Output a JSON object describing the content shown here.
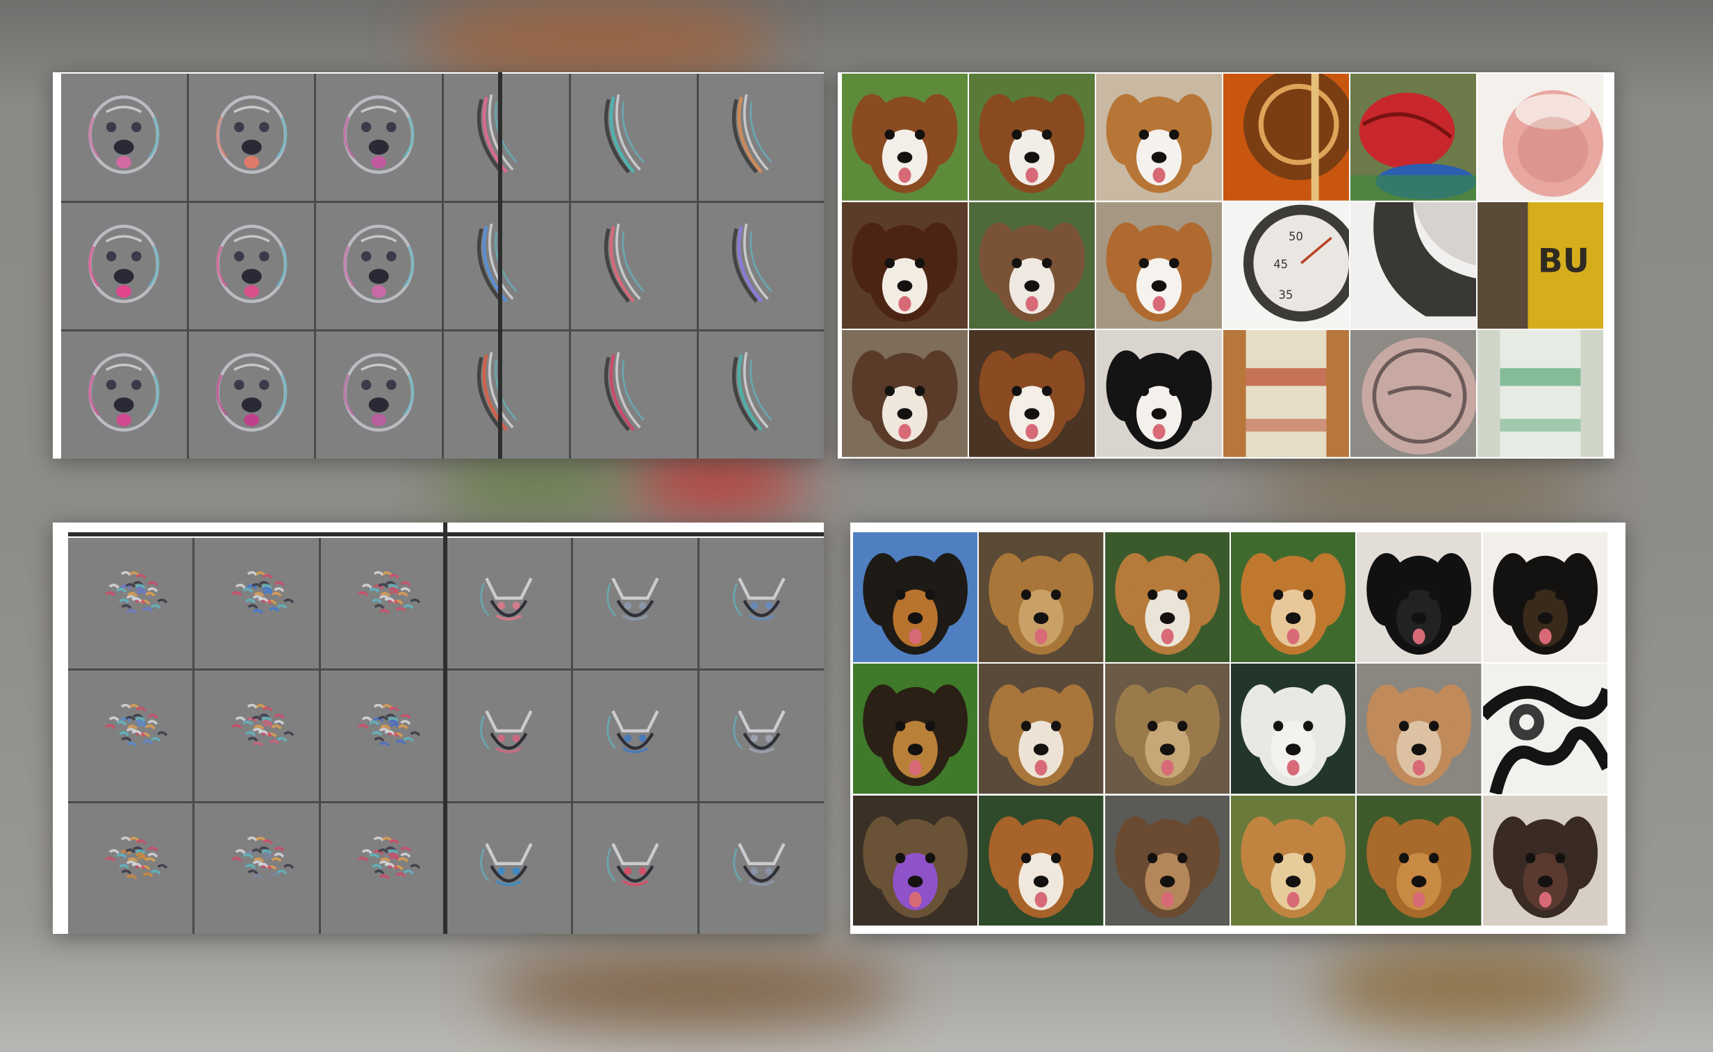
{
  "panels": [
    {
      "id": "top-feature-vis",
      "kind": "feature-visualizations",
      "cols": 6,
      "rows": 3,
      "cells": [
        {
          "motif": "dog-face",
          "hue": "#d36aa2"
        },
        {
          "motif": "dog-face",
          "hue": "#e07a6a"
        },
        {
          "motif": "dog-face",
          "hue": "#c25aa0"
        },
        {
          "motif": "curve",
          "hue": "#d96a8f"
        },
        {
          "motif": "curve",
          "hue": "#4fb3b0"
        },
        {
          "motif": "curve",
          "hue": "#d08a5a"
        },
        {
          "motif": "dog-face",
          "hue": "#e0458c"
        },
        {
          "motif": "dog-face",
          "hue": "#d9508d"
        },
        {
          "motif": "dog-face",
          "hue": "#c86aa6"
        },
        {
          "motif": "curve",
          "hue": "#5a8fd0"
        },
        {
          "motif": "curve",
          "hue": "#d6697a"
        },
        {
          "motif": "curve",
          "hue": "#8a7ad8"
        },
        {
          "motif": "dog-face",
          "hue": "#d04a90"
        },
        {
          "motif": "dog-face",
          "hue": "#c0408c"
        },
        {
          "motif": "dog-face",
          "hue": "#b8609e"
        },
        {
          "motif": "curve",
          "hue": "#d2604a"
        },
        {
          "motif": "curve",
          "hue": "#c94a6a"
        },
        {
          "motif": "curve",
          "hue": "#4fb0a8"
        }
      ]
    },
    {
      "id": "top-photos",
      "kind": "image-patches",
      "cols": 6,
      "rows": 3,
      "cells": [
        {
          "subject": "dog",
          "bg": "#5e8b3a",
          "coat": "#8a4a22",
          "face": "#f3efe8"
        },
        {
          "subject": "dog",
          "bg": "#5a7a3a",
          "coat": "#8a4a20",
          "face": "#f2ede6"
        },
        {
          "subject": "dog",
          "bg": "#c9b9a3",
          "coat": "#b77636",
          "face": "#f5f2ee"
        },
        {
          "subject": "guitar",
          "bg": "#c9560f",
          "main": "#7a3e12",
          "accent": "#e0a35a"
        },
        {
          "subject": "bird",
          "bg": "#6d7a4a",
          "main": "#c8272b",
          "accent": "#2c5fb0"
        },
        {
          "subject": "bowl",
          "bg": "#f4f0ec",
          "main": "#e8a7a0",
          "accent": "#c9796f"
        },
        {
          "subject": "dog",
          "bg": "#5b3b2a",
          "coat": "#4b2414",
          "face": "#f3ece3"
        },
        {
          "subject": "dog",
          "bg": "#4f6a3a",
          "coat": "#7a5236",
          "face": "#efe9e2"
        },
        {
          "subject": "dog",
          "bg": "#a59782",
          "coat": "#b06a30",
          "face": "#f6f2ed"
        },
        {
          "subject": "gauge",
          "bg": "#f5f4f2",
          "main": "#3c3b38",
          "accent": "#eae7e2"
        },
        {
          "subject": "strap",
          "bg": "#f1f0ee",
          "main": "#3a3835",
          "accent": "#d6d3cf"
        },
        {
          "subject": "tin",
          "bg": "#7a6a52",
          "main": "#d6ad1d",
          "accent": "#2f2a22"
        },
        {
          "subject": "dog",
          "bg": "#7d6d5a",
          "coat": "#5a3a28",
          "face": "#efe6dc"
        },
        {
          "subject": "dog",
          "bg": "#4a3424",
          "coat": "#8a4a22",
          "face": "#f4eee6"
        },
        {
          "subject": "dog",
          "bg": "#d9d4ce",
          "coat": "#141414",
          "face": "#f4f1ec"
        },
        {
          "subject": "can",
          "bg": "#b8763a",
          "main": "#e7ddc6",
          "accent": "#b8452a"
        },
        {
          "subject": "lid",
          "bg": "#8e8a86",
          "main": "#c7a8a2",
          "accent": "#6a5a58"
        },
        {
          "subject": "can",
          "bg": "#cfd6c8",
          "main": "#e6ebe3",
          "accent": "#5aa878"
        }
      ]
    },
    {
      "id": "bottom-feature-vis",
      "kind": "feature-visualizations",
      "cols": 6,
      "rows": 3,
      "cells": [
        {
          "motif": "blob",
          "hue": "#6a7ad0"
        },
        {
          "motif": "blob",
          "hue": "#3f7ad8"
        },
        {
          "motif": "blob",
          "hue": "#d0506a"
        },
        {
          "motif": "fox",
          "hue": "#d47a8a"
        },
        {
          "motif": "fox",
          "hue": "#8a96a8"
        },
        {
          "motif": "fox",
          "hue": "#6a8ab8"
        },
        {
          "motif": "blob",
          "hue": "#5a8ad0"
        },
        {
          "motif": "blob",
          "hue": "#d0607a"
        },
        {
          "motif": "blob",
          "hue": "#4a70c8"
        },
        {
          "motif": "fox",
          "hue": "#c86a80"
        },
        {
          "motif": "fox",
          "hue": "#4a7ab8"
        },
        {
          "motif": "fox",
          "hue": "#9aa0ae"
        },
        {
          "motif": "blob",
          "hue": "#d08a3a"
        },
        {
          "motif": "blob",
          "hue": "#7a86a0"
        },
        {
          "motif": "blob",
          "hue": "#d04a6a"
        },
        {
          "motif": "fox",
          "hue": "#3f8ac0"
        },
        {
          "motif": "fox",
          "hue": "#d0506a"
        },
        {
          "motif": "fox",
          "hue": "#8a92a6"
        }
      ]
    },
    {
      "id": "bottom-photos",
      "kind": "image-patches",
      "cols": 6,
      "rows": 3,
      "cells": [
        {
          "subject": "dog",
          "bg": "#4f7fc0",
          "coat": "#1e1a16",
          "face": "#b8732e"
        },
        {
          "subject": "dog",
          "bg": "#5a4a36",
          "coat": "#a87638",
          "face": "#c9a066"
        },
        {
          "subject": "dog",
          "bg": "#3a5a2c",
          "coat": "#b67a3a",
          "face": "#ebe4d8"
        },
        {
          "subject": "dog",
          "bg": "#3f6a2e",
          "coat": "#c0782f",
          "face": "#e8c89a"
        },
        {
          "subject": "dog",
          "bg": "#e2ddd7",
          "coat": "#111111",
          "face": "#222222"
        },
        {
          "subject": "dog",
          "bg": "#f2efea",
          "coat": "#141210",
          "face": "#3a2a1c"
        },
        {
          "subject": "dog",
          "bg": "#3f7a2a",
          "coat": "#2a2016",
          "face": "#b9803a"
        },
        {
          "subject": "dog",
          "bg": "#5a4a3a",
          "coat": "#a8753a",
          "face": "#ece3d4"
        },
        {
          "subject": "dog",
          "bg": "#6a5a46",
          "coat": "#9a7a4a",
          "face": "#c7a678"
        },
        {
          "subject": "dog",
          "bg": "#23362a",
          "coat": "#e8e8e4",
          "face": "#f3f2ef"
        },
        {
          "subject": "dog",
          "bg": "#8a8680",
          "coat": "#c08a5a",
          "face": "#dcc2a2"
        },
        {
          "subject": "fence",
          "bg": "#f3f1ee",
          "main": "#141414",
          "accent": "#3a3a3a"
        },
        {
          "subject": "dog",
          "bg": "#3a3026",
          "coat": "#6a5236",
          "face": "#8f52c8"
        },
        {
          "subject": "dog",
          "bg": "#2e4a2a",
          "coat": "#a8632a",
          "face": "#f0e8dc"
        },
        {
          "subject": "dog",
          "bg": "#5a5a56",
          "coat": "#6a4a30",
          "face": "#b4875a"
        },
        {
          "subject": "dog",
          "bg": "#6a7a3a",
          "coat": "#c08440",
          "face": "#e6cc9a"
        },
        {
          "subject": "dog",
          "bg": "#3f5a2a",
          "coat": "#a86a2a",
          "face": "#c98a44"
        },
        {
          "subject": "dog",
          "bg": "#d8cfc4",
          "coat": "#3a2a24",
          "face": "#5a3a30"
        }
      ]
    }
  ]
}
